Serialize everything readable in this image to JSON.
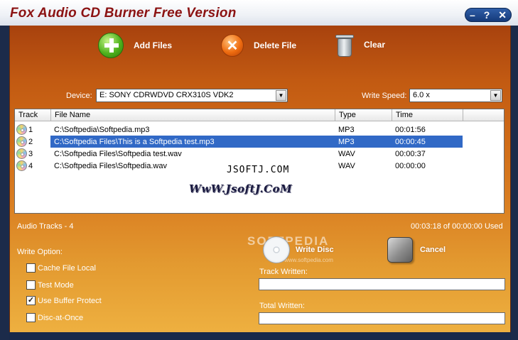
{
  "window": {
    "title": "Fox Audio CD Burner Free Version"
  },
  "window_controls": {
    "minimize": "–",
    "help": "?",
    "close": "✕"
  },
  "toolbar": {
    "add_files": "Add Files",
    "delete_file": "Delete File",
    "clear": "Clear"
  },
  "device": {
    "label": "Device:",
    "value": "E: SONY CDRWDVD CRX310S VDK2"
  },
  "write_speed": {
    "label": "Write Speed:",
    "value": "6.0 x"
  },
  "tracks": {
    "columns": [
      "Track",
      "File Name",
      "Type",
      "Time"
    ],
    "rows": [
      {
        "track": "1",
        "file": "C:\\Softpedia\\Softpedia.mp3",
        "type": "MP3",
        "time": "00:01:56"
      },
      {
        "track": "2",
        "file": "C:\\Softpedia Files\\This is a Softpedia test.mp3",
        "type": "MP3",
        "time": "00:00:45"
      },
      {
        "track": "3",
        "file": "C:\\Softpedia Files\\Softpedia test.wav",
        "type": "WAV",
        "time": "00:00:37"
      },
      {
        "track": "4",
        "file": "C:\\Softpedia Files\\Softpedia.wav",
        "type": "WAV",
        "time": "00:00:00"
      }
    ],
    "selected_index": 1
  },
  "watermarks": {
    "jsoftj": "JSOFTJ.COM",
    "jsoftj_url": "WwW.JsoftJ.CoM",
    "softpedia": "SOFTPEDIA",
    "softpedia_url": "www.softpedia.com"
  },
  "summary": {
    "audio_tracks": "Audio Tracks -  4",
    "time_used": "00:03:18 of 00:00:00 Used"
  },
  "write_option": {
    "label": "Write Option:",
    "options": [
      {
        "label": "Cache File Local",
        "checked": false
      },
      {
        "label": "Test Mode",
        "checked": false
      },
      {
        "label": "Use Buffer Protect",
        "checked": true
      },
      {
        "label": "Disc-at-Once",
        "checked": false
      }
    ]
  },
  "actions": {
    "write_disc": "Write Disc",
    "cancel": "Cancel"
  },
  "progress": {
    "track_written": "Track Written:",
    "total_written": "Total Written:"
  }
}
